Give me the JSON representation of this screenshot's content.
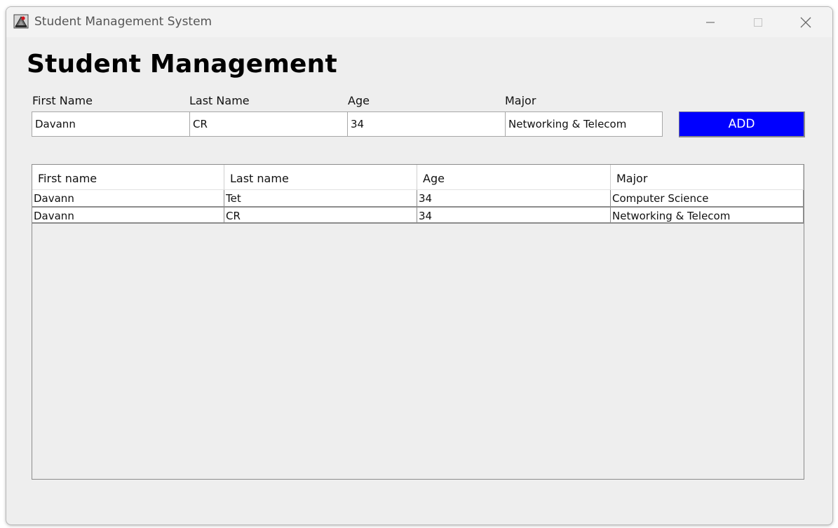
{
  "window": {
    "title": "Student Management System",
    "icon": "java-app-icon",
    "controls": [
      "minimize-icon",
      "maximize-icon",
      "close-icon"
    ]
  },
  "heading": "Student Management",
  "form": {
    "fields": [
      {
        "label": "First Name",
        "value": "Davann"
      },
      {
        "label": "Last Name",
        "value": "CR"
      },
      {
        "label": "Age",
        "value": "34"
      },
      {
        "label": "Major",
        "value": "Networking & Telecom"
      }
    ],
    "add_label": "ADD"
  },
  "table": {
    "columns": [
      "First name",
      "Last name",
      "Age",
      "Major"
    ],
    "rows": [
      [
        "Davann",
        "Tet",
        "34",
        "Computer Science"
      ],
      [
        "Davann",
        "CR",
        "34",
        "Networking & Telecom"
      ]
    ]
  },
  "colors": {
    "accent_button": "#0000ff",
    "window_bg": "#eeeeee"
  }
}
